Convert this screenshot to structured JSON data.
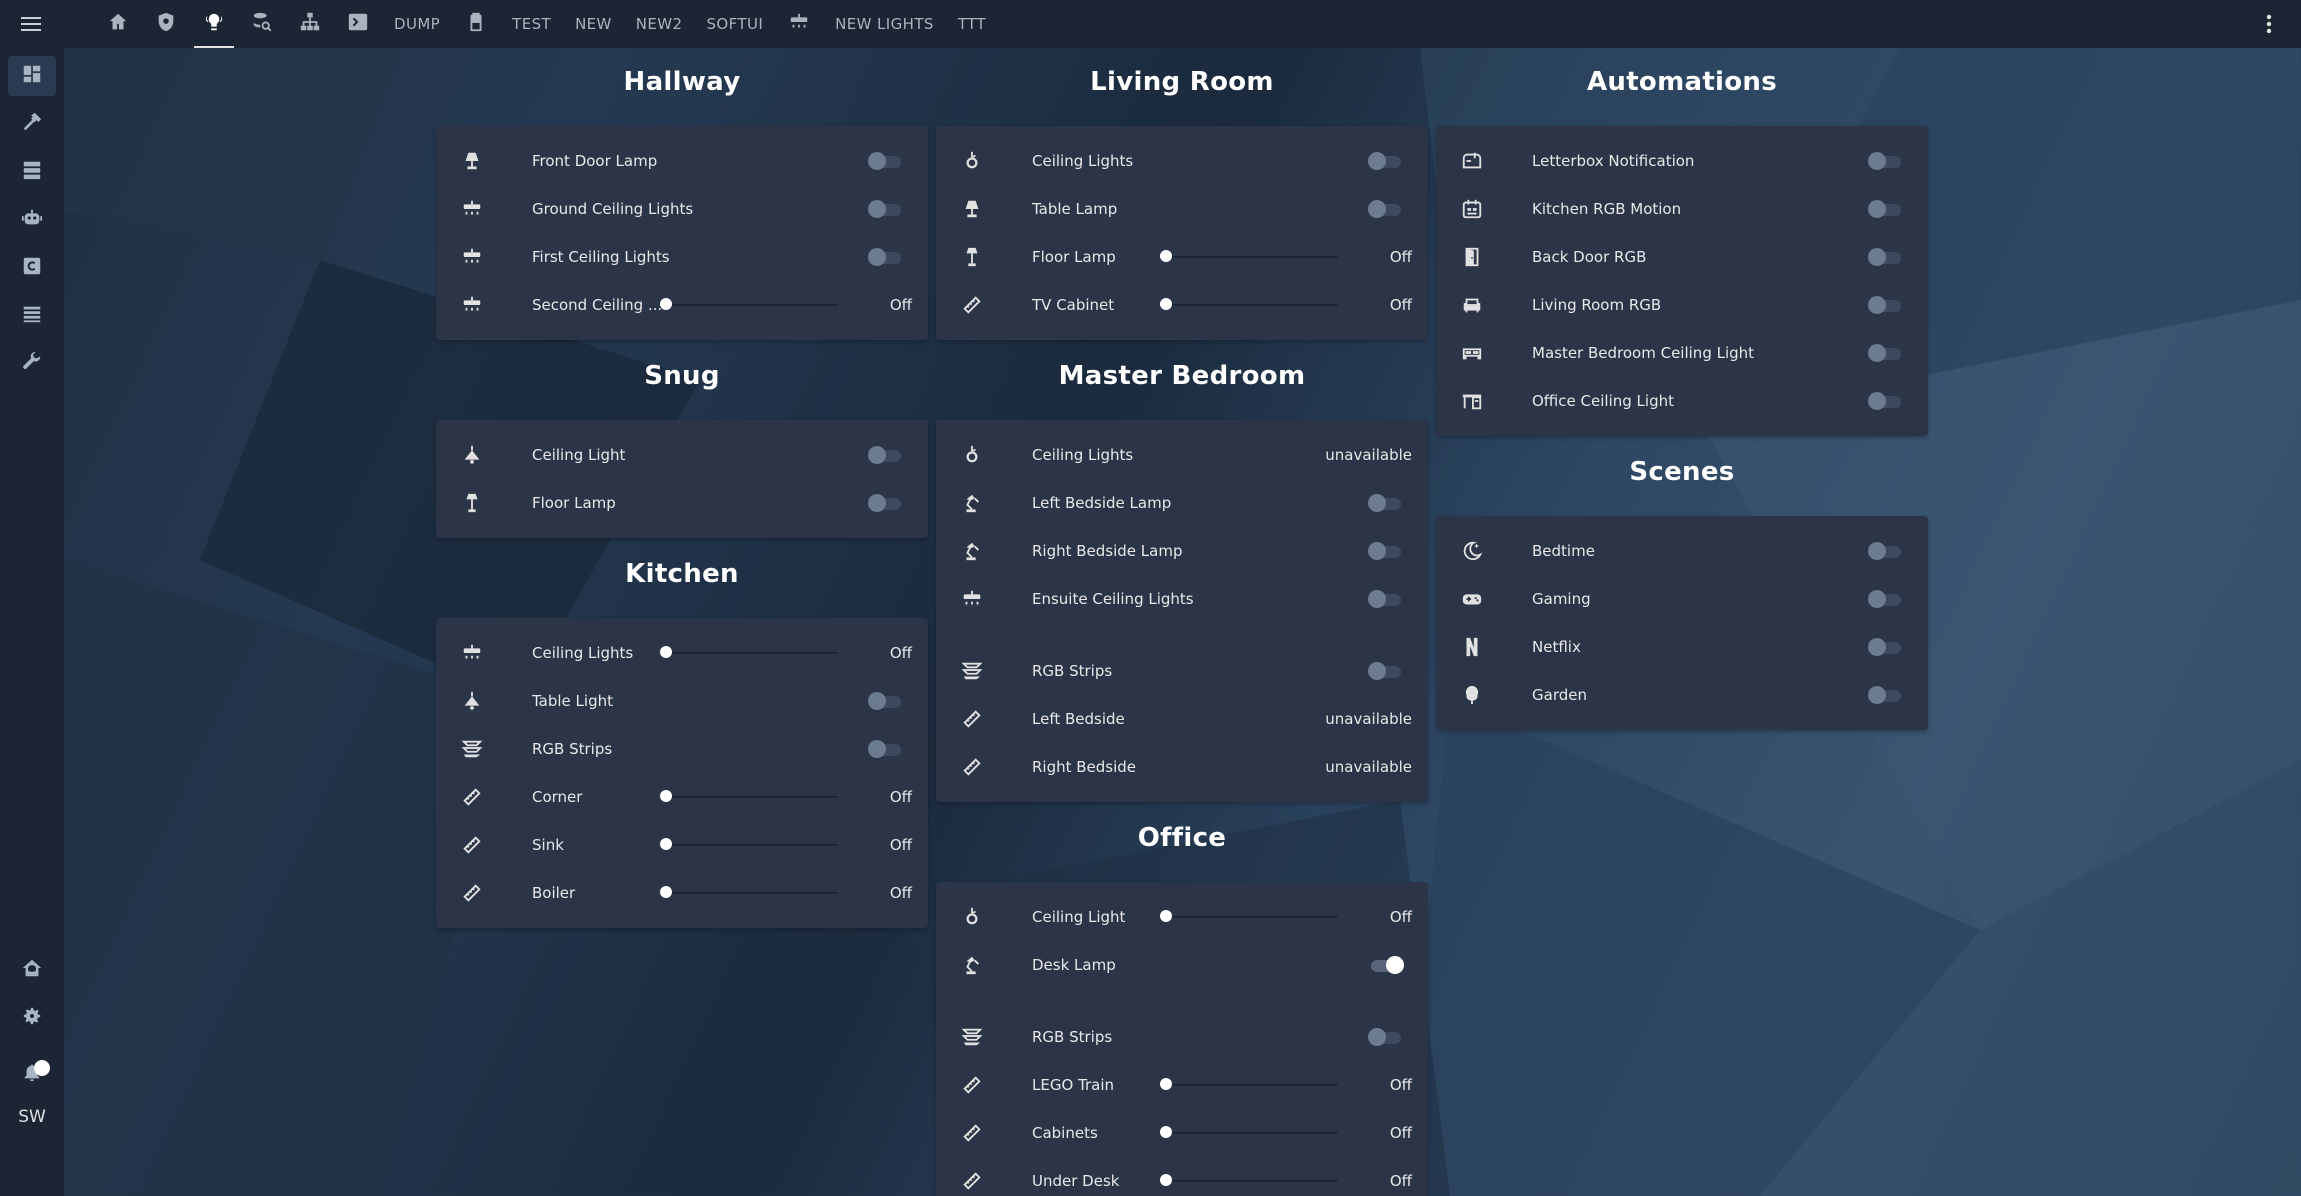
{
  "topbar": {
    "tabs": [
      {
        "type": "icon",
        "icon": "home-icon"
      },
      {
        "type": "icon",
        "icon": "shield-icon"
      },
      {
        "type": "icon",
        "icon": "lightbulb-group-icon",
        "active": true
      },
      {
        "type": "icon",
        "icon": "database-search-icon"
      },
      {
        "type": "icon",
        "icon": "network-icon"
      },
      {
        "type": "icon",
        "icon": "console-icon"
      },
      {
        "type": "text",
        "label": "DUMP"
      },
      {
        "type": "icon",
        "icon": "battery-icon"
      },
      {
        "type": "text",
        "label": "TEST"
      },
      {
        "type": "text",
        "label": "NEW"
      },
      {
        "type": "text",
        "label": "NEW2"
      },
      {
        "type": "text",
        "label": "SOFTUI"
      },
      {
        "type": "icon",
        "icon": "ceiling-light-icon"
      },
      {
        "type": "text",
        "label": "NEW LIGHTS"
      },
      {
        "type": "text",
        "label": "TTT"
      }
    ]
  },
  "sidebar": {
    "items": [
      "dashboard-icon",
      "hammer-icon",
      "server-icon",
      "robot-icon",
      "letter-c-icon",
      "list-icon",
      "wrench-icon"
    ],
    "bottom": [
      "home-automation-icon",
      "gear-icon",
      "bell-icon"
    ],
    "user_initials": "SW"
  },
  "columns": [
    [
      {
        "title": "Hallway",
        "rows": [
          {
            "icon": "lamp-icon",
            "name": "Front Door Lamp",
            "control": "toggle",
            "on": false
          },
          {
            "icon": "ceiling-light-icon",
            "name": "Ground Ceiling Lights",
            "control": "toggle",
            "on": false
          },
          {
            "icon": "ceiling-light-icon",
            "name": "First Ceiling Lights",
            "control": "toggle",
            "on": false
          },
          {
            "icon": "ceiling-light-icon",
            "name": "Second Ceiling ...",
            "control": "slider",
            "level": 0,
            "state": "Off"
          }
        ]
      },
      {
        "title": "Snug",
        "rows": [
          {
            "icon": "pendant-light-icon",
            "name": "Ceiling Light",
            "control": "toggle",
            "on": false
          },
          {
            "icon": "floor-lamp-icon",
            "name": "Floor Lamp",
            "control": "toggle",
            "on": false
          }
        ]
      },
      {
        "title": "Kitchen",
        "rows": [
          {
            "icon": "ceiling-light-icon",
            "name": "Ceiling Lights",
            "control": "slider",
            "level": 0,
            "state": "Off"
          },
          {
            "icon": "pendant-light-icon",
            "name": "Table Light",
            "control": "toggle",
            "on": false
          },
          {
            "icon": "led-strip-icon",
            "name": "RGB Strips",
            "control": "toggle",
            "on": false
          },
          {
            "icon": "led-strip-flat-icon",
            "name": "Corner",
            "control": "slider",
            "level": 0,
            "state": "Off"
          },
          {
            "icon": "led-strip-flat-icon",
            "name": "Sink",
            "control": "slider",
            "level": 0,
            "state": "Off"
          },
          {
            "icon": "led-strip-flat-icon",
            "name": "Boiler",
            "control": "slider",
            "level": 0,
            "state": "Off"
          }
        ]
      }
    ],
    [
      {
        "title": "Living Room",
        "rows": [
          {
            "icon": "hanging-bulb-icon",
            "name": "Ceiling Lights",
            "control": "toggle",
            "on": false
          },
          {
            "icon": "lamp-icon",
            "name": "Table Lamp",
            "control": "toggle",
            "on": false
          },
          {
            "icon": "floor-lamp-icon",
            "name": "Floor Lamp",
            "control": "slider",
            "level": 0,
            "state": "Off"
          },
          {
            "icon": "led-strip-flat-icon",
            "name": "TV Cabinet",
            "control": "slider",
            "level": 0,
            "state": "Off"
          }
        ]
      },
      {
        "title": "Master Bedroom",
        "rows": [
          {
            "icon": "hanging-bulb-icon",
            "name": "Ceiling Lights",
            "control": "state",
            "state": "unavailable"
          },
          {
            "icon": "desk-lamp-icon",
            "name": "Left Bedside Lamp",
            "control": "toggle",
            "on": false
          },
          {
            "icon": "desk-lamp-icon",
            "name": "Right Bedside Lamp",
            "control": "toggle",
            "on": false
          },
          {
            "icon": "ceiling-light-icon",
            "name": "Ensuite Ceiling Lights",
            "control": "toggle",
            "on": false
          },
          {
            "control": "gap"
          },
          {
            "icon": "led-strip-icon",
            "name": "RGB Strips",
            "control": "toggle",
            "on": false
          },
          {
            "icon": "led-strip-flat-icon",
            "name": "Left Bedside",
            "control": "state",
            "state": "unavailable"
          },
          {
            "icon": "led-strip-flat-icon",
            "name": "Right Bedside",
            "control": "state",
            "state": "unavailable"
          }
        ]
      },
      {
        "title": "Office",
        "rows": [
          {
            "icon": "hanging-bulb-icon",
            "name": "Ceiling Light",
            "control": "slider",
            "level": 0,
            "state": "Off"
          },
          {
            "icon": "desk-lamp-icon",
            "name": "Desk Lamp",
            "control": "toggle",
            "on": true
          },
          {
            "control": "gap"
          },
          {
            "icon": "led-strip-icon",
            "name": "RGB Strips",
            "control": "toggle",
            "on": false
          },
          {
            "icon": "led-strip-flat-icon",
            "name": "LEGO Train",
            "control": "slider",
            "level": 0,
            "state": "Off"
          },
          {
            "icon": "led-strip-flat-icon",
            "name": "Cabinets",
            "control": "slider",
            "level": 0,
            "state": "Off"
          },
          {
            "icon": "led-strip-flat-icon",
            "name": "Under Desk",
            "control": "slider",
            "level": 0,
            "state": "Off"
          }
        ]
      }
    ],
    [
      {
        "title": "Automations",
        "rows": [
          {
            "icon": "mailbox-icon",
            "name": "Letterbox Notification",
            "control": "toggle",
            "on": false
          },
          {
            "icon": "calendar-motion-icon",
            "name": "Kitchen RGB Motion",
            "control": "toggle",
            "on": false
          },
          {
            "icon": "door-icon",
            "name": "Back Door RGB",
            "control": "toggle",
            "on": false
          },
          {
            "icon": "sofa-icon",
            "name": "Living Room RGB",
            "control": "toggle",
            "on": false
          },
          {
            "icon": "bed-icon",
            "name": "Master Bedroom Ceiling Light",
            "control": "toggle",
            "on": false
          },
          {
            "icon": "desk-icon",
            "name": "Office Ceiling Light",
            "control": "toggle",
            "on": false
          }
        ]
      },
      {
        "title": "Scenes",
        "rows": [
          {
            "icon": "moon-icon",
            "name": "Bedtime",
            "control": "toggle",
            "on": false
          },
          {
            "icon": "gamepad-icon",
            "name": "Gaming",
            "control": "toggle",
            "on": false
          },
          {
            "icon": "netflix-icon",
            "name": "Netflix",
            "control": "toggle",
            "on": false
          },
          {
            "icon": "tree-icon",
            "name": "Garden",
            "control": "toggle",
            "on": false
          }
        ]
      }
    ]
  ]
}
